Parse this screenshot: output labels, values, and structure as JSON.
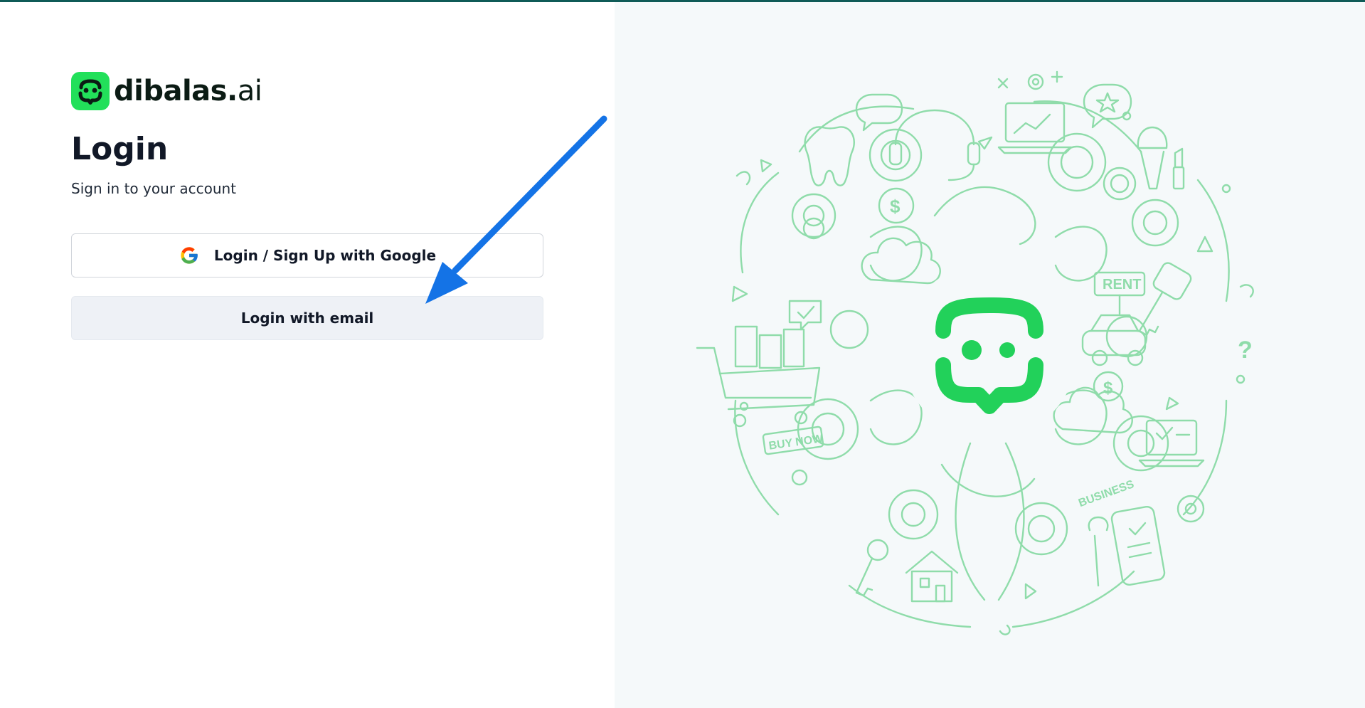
{
  "brand": {
    "name": "dibalas",
    "dot": ".",
    "tld": "ai",
    "color": "#22e05a"
  },
  "login": {
    "title": "Login",
    "subtitle": "Sign in to your account",
    "google_button_label": "Login / Sign Up with Google",
    "email_button_label": "Login with email"
  },
  "illustration": {
    "labels": {
      "rent": "RENT",
      "buy_now": "BUY NOW",
      "business": "BUSINESS",
      "dollar": "$",
      "question": "?"
    },
    "line_color": "#8fdcaa",
    "accent_color": "#22d15a"
  },
  "annotation": {
    "arrow_color": "#1473e6"
  }
}
